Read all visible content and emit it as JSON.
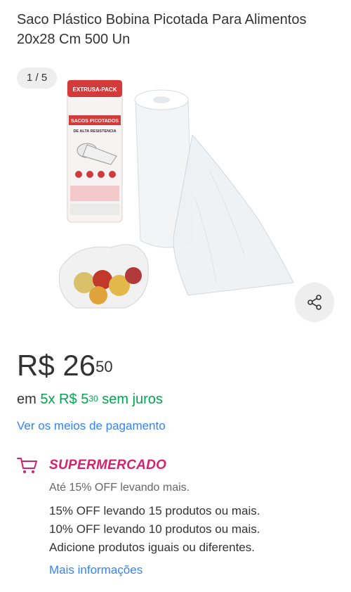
{
  "product": {
    "title": "Saco Plástico Bobina Picotada Para Alimentos 20x28 Cm 500 Un"
  },
  "gallery": {
    "counter": "1 / 5",
    "package_brand": "EXTRUSA-PACK",
    "package_text": "SACOS PICOTADOS",
    "package_subtext": "DE ALTA RESISTENCIA",
    "share_icon": "share-icon"
  },
  "price": {
    "currency": "R$",
    "integer": "26",
    "cents": "50"
  },
  "installments": {
    "prefix": "em",
    "count": "5x",
    "currency": "R$",
    "integer": "5",
    "cents": "30",
    "suffix": "sem juros"
  },
  "payment": {
    "link_label": "Ver os meios de pagamento"
  },
  "promo": {
    "store_label": "SUPERMERCADO",
    "subtitle": "Até 15% OFF levando mais.",
    "lines": [
      "15% OFF levando 15 produtos ou mais.",
      "10% OFF levando 10 produtos ou mais.",
      "Adicione produtos iguais ou diferentes."
    ],
    "more_label": "Mais informações",
    "cart_icon": "cart-icon"
  },
  "colors": {
    "link": "#3483fa",
    "green": "#00a650",
    "supermarket": "#d6226e",
    "text": "#333333",
    "muted": "#666666"
  }
}
